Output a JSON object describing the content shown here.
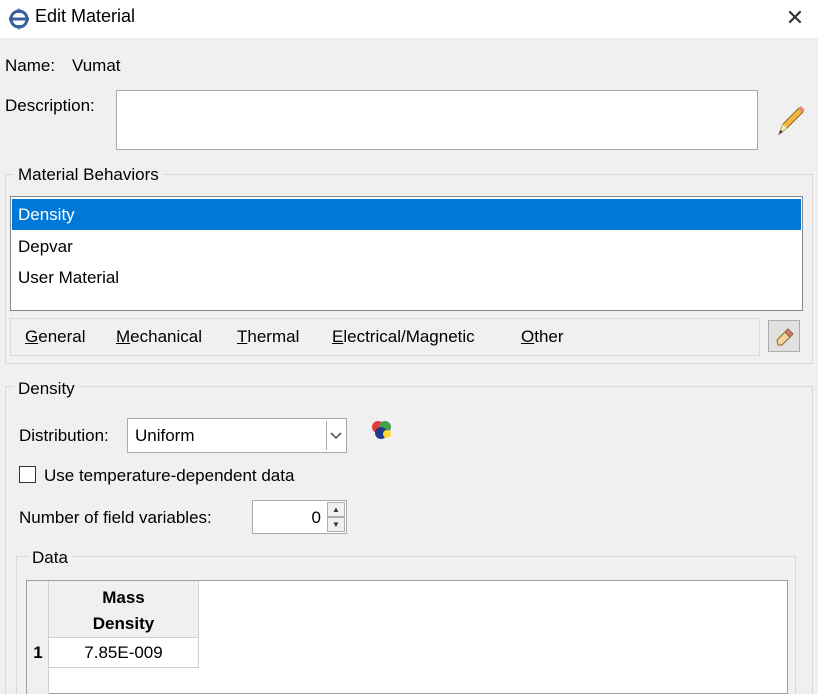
{
  "window": {
    "title": "Edit Material",
    "close_glyph": "✕"
  },
  "name_field": {
    "label": "Name:",
    "value": "Vumat"
  },
  "description": {
    "label": "Description:",
    "value": ""
  },
  "behaviors": {
    "group_title": "Material Behaviors",
    "items": [
      {
        "label": "Density",
        "selected": true
      },
      {
        "label": "Depvar",
        "selected": false
      },
      {
        "label": "User Material",
        "selected": false
      }
    ]
  },
  "menu": {
    "items": [
      {
        "mnemonic": "G",
        "rest": "eneral"
      },
      {
        "mnemonic": "M",
        "rest": "echanical"
      },
      {
        "mnemonic": "T",
        "rest": "hermal"
      },
      {
        "mnemonic": "E",
        "rest": "lectrical/Magnetic"
      },
      {
        "mnemonic": "O",
        "rest": "ther"
      }
    ]
  },
  "density": {
    "group_title": "Density",
    "distribution_label": "Distribution:",
    "distribution_value": "Uniform",
    "temp_checkbox_label": "Use temperature-dependent data",
    "temp_checked": false,
    "field_vars_label": "Number of field variables:",
    "field_vars_value": "0"
  },
  "data": {
    "group_title": "Data",
    "column_header_line1": "Mass",
    "column_header_line2": "Density",
    "rows": [
      {
        "index": "1",
        "mass_density": "7.85E-009"
      }
    ]
  },
  "colors": {
    "selection": "#0078d7",
    "background": "#f0f0f0"
  },
  "icons": [
    "app-crosshair-icon",
    "close-icon",
    "pencil-icon",
    "eraser-icon",
    "dropdown-arrow-icon",
    "color-blob-icon",
    "spin-up-icon",
    "spin-down-icon"
  ]
}
